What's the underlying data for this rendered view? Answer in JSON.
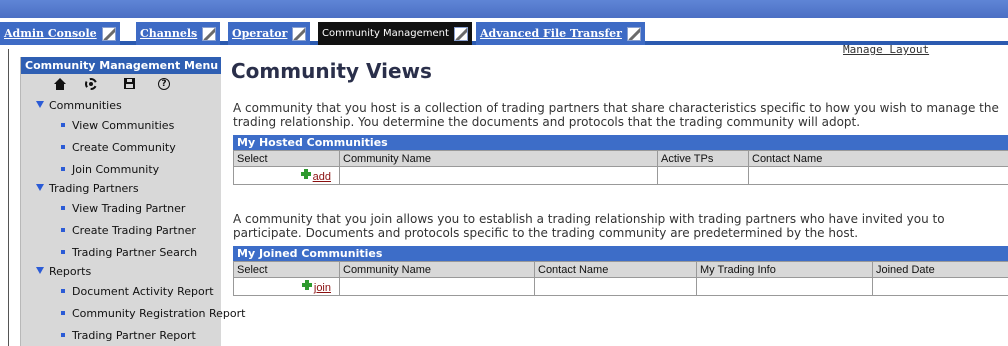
{
  "tabs": [
    {
      "label": "Admin Console",
      "active": false
    },
    {
      "label": "Channels",
      "active": false
    },
    {
      "label": "Operator",
      "active": false
    },
    {
      "label": "Community Management",
      "active": true
    },
    {
      "label": "Advanced File Transfer",
      "active": false
    }
  ],
  "manage_layout": "Manage Layout",
  "menu": {
    "title": "Community Management Menu",
    "icons": [
      "home-icon",
      "gear-icon",
      "save-icon",
      "help-icon"
    ],
    "sections": [
      {
        "label": "Communities",
        "items": [
          "View Communities",
          "Create Community",
          "Join Community"
        ]
      },
      {
        "label": "Trading Partners",
        "items": [
          "View Trading Partner",
          "Create Trading Partner",
          "Trading Partner Search"
        ]
      },
      {
        "label": "Reports",
        "items": [
          "Document Activity Report",
          "Community Registration Report",
          "Trading Partner Report"
        ]
      }
    ]
  },
  "main": {
    "title": "Community Views",
    "hosted_desc": "A community that you host is a collection of trading partners that share characteristics specific to how you wish to manage the trading relationship. You determine the documents and protocols that the trading community will adopt.",
    "hosted": {
      "header": "My Hosted Communities",
      "columns": [
        "Select",
        "Community Name",
        "Active TPs",
        "Contact Name"
      ],
      "action": "add"
    },
    "joined_desc": "A community that you join allows you to establish a trading relationship with trading partners who have invited you to participate. Documents and protocols specific to the trading community are predetermined by the host.",
    "joined": {
      "header": "My Joined Communities",
      "columns": [
        "Select",
        "Community Name",
        "Contact Name",
        "My Trading Info",
        "Joined Date"
      ],
      "action": "join"
    }
  },
  "colors": {
    "accent_blue": "#3d6dc8",
    "tab_blue": "#3e6bc5",
    "active_tab": "#111111",
    "menu_bg": "#d8d8d8",
    "link_red": "#8b1010",
    "plus_green": "#2e9a2e"
  }
}
